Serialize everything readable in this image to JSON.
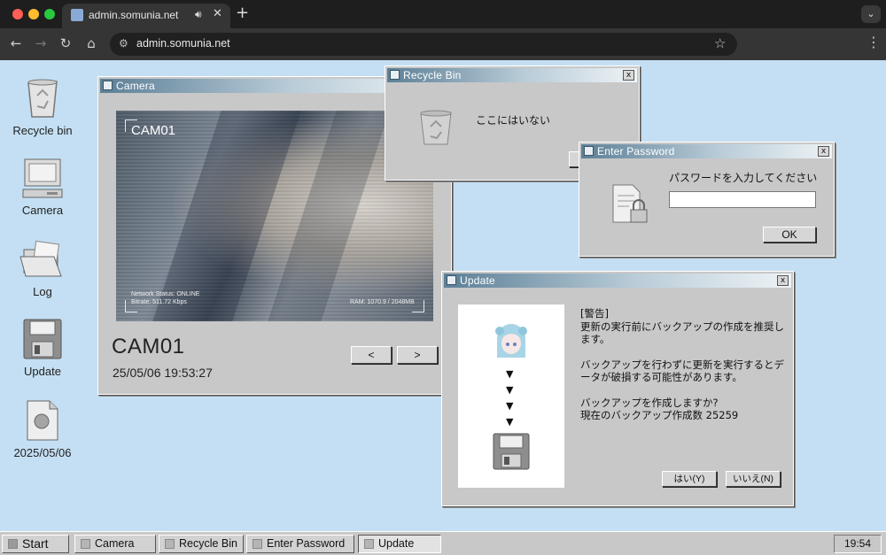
{
  "browser": {
    "tab_title": "admin.somunia.net",
    "url": "admin.somunia.net",
    "traffic_colors": [
      "#ff5f57",
      "#febc2e",
      "#28c840"
    ]
  },
  "desktop_icons": [
    {
      "label": "Recycle bin",
      "icon": "recycle-bin-icon"
    },
    {
      "label": "Camera",
      "icon": "computer-icon"
    },
    {
      "label": "Log",
      "icon": "folder-icon"
    },
    {
      "label": "Update",
      "icon": "floppy-disk-icon"
    },
    {
      "label": "2025/05/06",
      "icon": "document-icon"
    }
  ],
  "camera_window": {
    "title": "Camera",
    "overlay_cam": "CAM01",
    "overlay_status": "Network Status: ONLINE",
    "overlay_bitrate": "Bitrate: 511.72 Kbps",
    "overlay_ram": "RAM: 1070.9 / 2048MB",
    "cam_name": "CAM01",
    "timestamp": "25/05/06 19:53:27",
    "prev_label": "<",
    "next_label": ">"
  },
  "recycle_window": {
    "title": "Recycle Bin",
    "message": "ここにはいない"
  },
  "password_window": {
    "title": "Enter Password",
    "prompt": "パスワードを入力してください",
    "input_value": "",
    "ok_label": "OK"
  },
  "update_window": {
    "title": "Update",
    "lines": [
      "[警告]",
      "更新の実行前にバックアップの作成を推奨し",
      "ます。",
      "",
      "バックアップを行わずに更新を実行するとデ",
      "ータが破損する可能性があります。",
      "",
      "バックアップを作成しますか?",
      "現在のバックアップ作成数 25259"
    ],
    "arrows": [
      "▼",
      "▼",
      "▼",
      "▼"
    ],
    "yes_label": "はい(Y)",
    "no_label": "いいえ(N)"
  },
  "taskbar": {
    "start_label": "Start",
    "items": [
      "Camera",
      "Recycle Bin",
      "Enter Password",
      "Update"
    ],
    "clock": "19:54"
  }
}
